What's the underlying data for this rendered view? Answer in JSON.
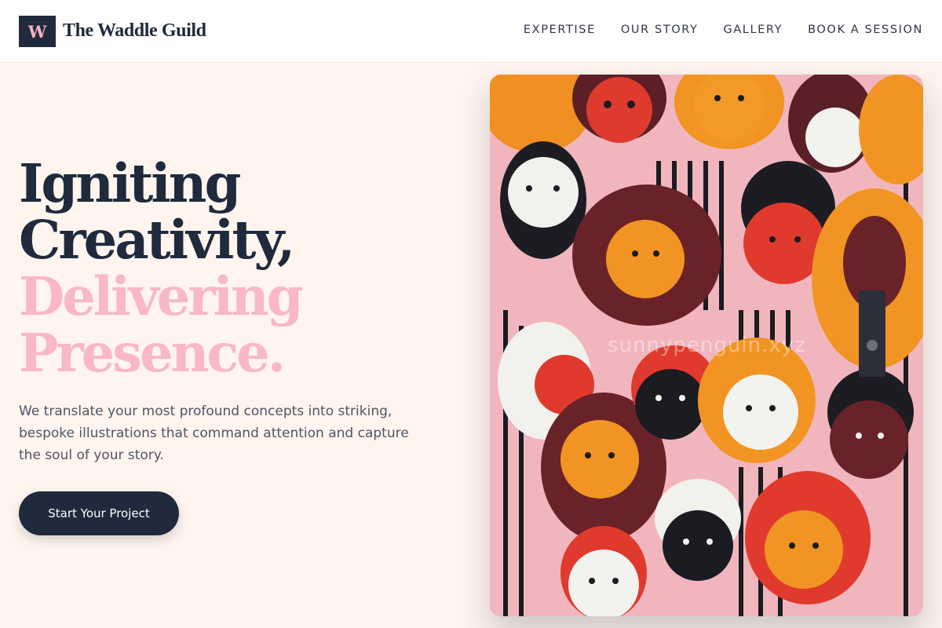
{
  "brand": {
    "logo_letter": "W",
    "name": "The Waddle Guild"
  },
  "nav": {
    "items": [
      {
        "label": "EXPERTISE"
      },
      {
        "label": "OUR STORY"
      },
      {
        "label": "GALLERY"
      },
      {
        "label": "BOOK A SESSION"
      }
    ]
  },
  "hero": {
    "headline_line1": "Igniting",
    "headline_line2": "Creativity,",
    "headline_line3": "Delivering",
    "headline_line4": "Presence.",
    "description": "We translate your most profound concepts into striking, bespoke illustrations that command attention and capture the soul of your story.",
    "cta_label": "Start Your Project"
  },
  "artwork": {
    "watermark": "sunnypenguin.xyz"
  },
  "colors": {
    "navy": "#1f2a3c",
    "pink": "#f8b8c4",
    "background": "#fff4ee"
  }
}
